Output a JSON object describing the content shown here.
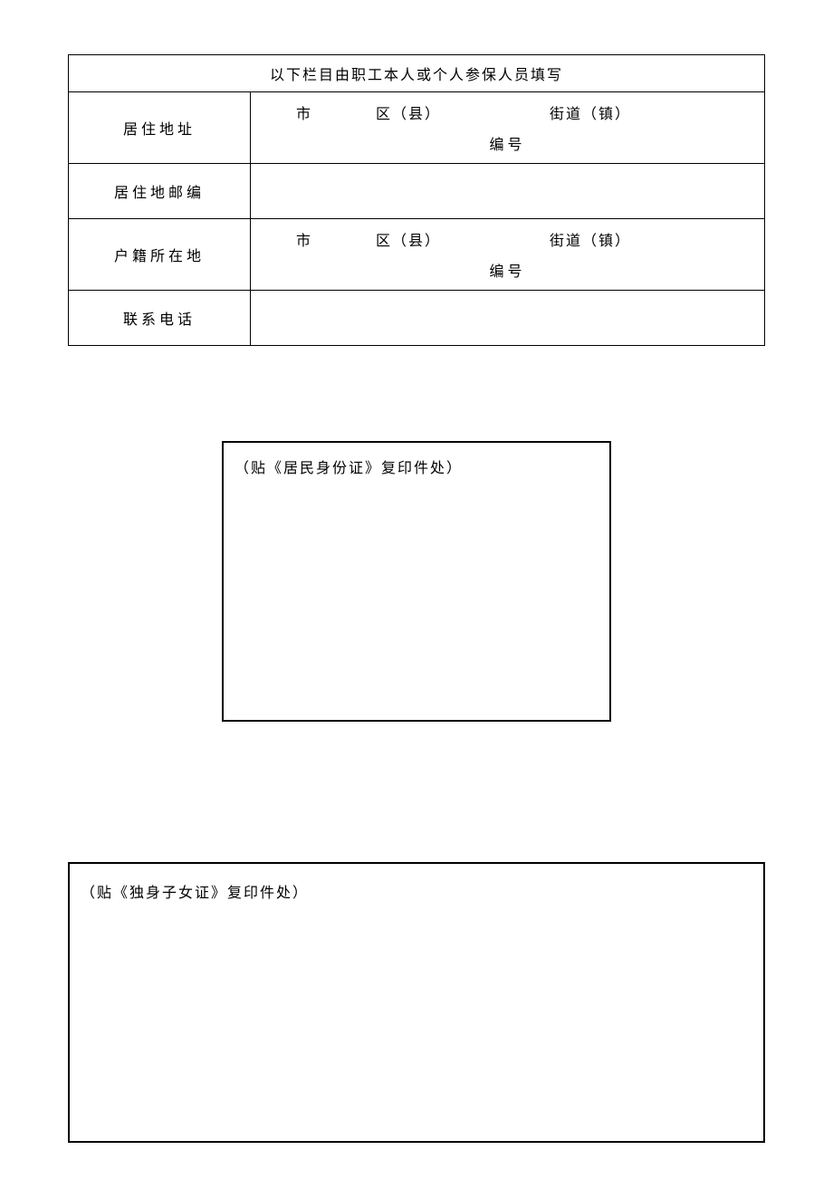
{
  "table": {
    "header": "以下栏目由职工本人或个人参保人员填写",
    "rows": {
      "addr_label": "居住地址",
      "postal_label": "居住地邮编",
      "hukou_label": "户籍所在地",
      "phone_label": "联系电话"
    },
    "addr_parts": {
      "city": "市",
      "district": "区（县）",
      "street": "街道（镇）",
      "number": "编号"
    }
  },
  "box1_text": "（贴《居民身份证》复印件处）",
  "box2_text": "（贴《独身子女证》复印件处）"
}
